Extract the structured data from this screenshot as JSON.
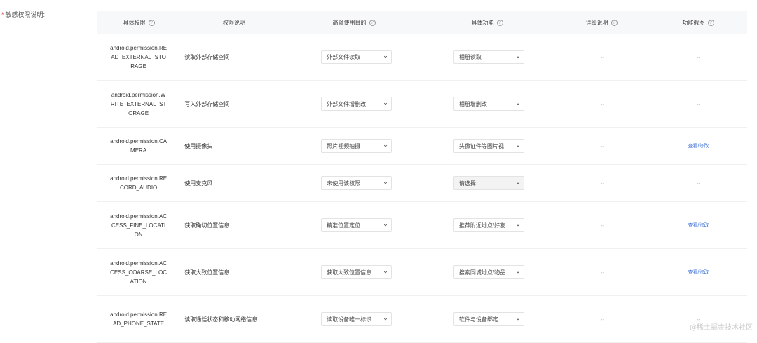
{
  "section_label": "敏感权限说明:",
  "required_mark": "*",
  "help_mark": "?",
  "headers": [
    "具体权限",
    "权限说明",
    "高频使用目的",
    "具体功能",
    "详细说明",
    "功能截图"
  ],
  "rows": [
    {
      "permission": "android.permission.READ_EXTERNAL_STORAGE",
      "description": "读取外部存储空间",
      "purpose": "外部文件读取",
      "function": "相册读取",
      "detail": "--",
      "screenshot": "--",
      "function_grey": false
    },
    {
      "permission": "android.permission.WRITE_EXTERNAL_STORAGE",
      "description": "写入外部存储空间",
      "purpose": "外部文件增删改",
      "function": "相册增删改",
      "detail": "--",
      "screenshot": "--",
      "function_grey": false
    },
    {
      "permission": "android.permission.CAMERA",
      "description": "使用摄像头",
      "purpose": "照片视频拍摄",
      "function": "头像证件等图片视",
      "detail": "--",
      "screenshot": "查看/修改",
      "function_grey": false
    },
    {
      "permission": "android.permission.RECORD_AUDIO",
      "description": "使用麦克风",
      "purpose": "未使用该权限",
      "function": "请选择",
      "detail": "--",
      "screenshot": "--",
      "function_grey": true
    },
    {
      "permission": "android.permission.ACCESS_FINE_LOCATION",
      "description": "获取确切位置信息",
      "purpose": "精准位置定位",
      "function": "推荐附近地点/好友",
      "detail": "--",
      "screenshot": "查看/修改",
      "function_grey": false
    },
    {
      "permission": "android.permission.ACCESS_COARSE_LOCATION",
      "description": "获取大致位置信息",
      "purpose": "获取大致位置信息",
      "function": "搜索同城地点/物品",
      "detail": "--",
      "screenshot": "查看/修改",
      "function_grey": false
    },
    {
      "permission": "android.permission.READ_PHONE_STATE",
      "description": "读取通话状态和移动网络信息",
      "purpose": "读取设备唯一标识",
      "function": "软件与设备绑定",
      "detail": "--",
      "screenshot": "--",
      "function_grey": false
    }
  ],
  "watermark": "@稀土掘金技术社区"
}
